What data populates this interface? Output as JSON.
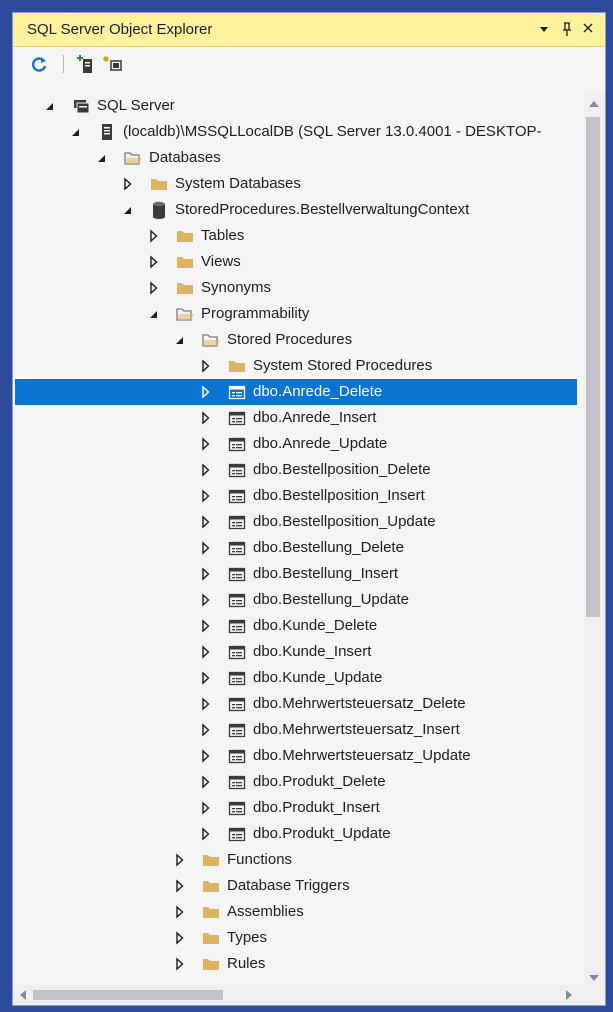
{
  "panel": {
    "title": "SQL Server Object Explorer",
    "dropdown_glyph": "▾",
    "pin_glyph": "ᵾ",
    "close_glyph": "✕"
  },
  "toolbar": {
    "refresh_icon": "refresh-icon",
    "add_server_icon": "add-sql-server-icon",
    "add_connection_icon": "add-connection-icon"
  },
  "tree": {
    "nodes": [
      {
        "label": "SQL Server",
        "level": 0,
        "state": "expanded",
        "icon": "server-group-icon"
      },
      {
        "label": "(localdb)\\MSSQLLocalDB (SQL Server 13.0.4001 - DESKTOP-",
        "level": 1,
        "state": "expanded",
        "icon": "server-icon"
      },
      {
        "label": "Databases",
        "level": 2,
        "state": "expanded",
        "icon": "folder-open-icon"
      },
      {
        "label": "System Databases",
        "level": 3,
        "state": "collapsed",
        "icon": "folder-icon"
      },
      {
        "label": "StoredProcedures.BestellverwaltungContext",
        "level": 3,
        "state": "expanded",
        "icon": "database-icon"
      },
      {
        "label": "Tables",
        "level": 4,
        "state": "collapsed",
        "icon": "folder-icon"
      },
      {
        "label": "Views",
        "level": 4,
        "state": "collapsed",
        "icon": "folder-icon"
      },
      {
        "label": "Synonyms",
        "level": 4,
        "state": "collapsed",
        "icon": "folder-icon"
      },
      {
        "label": "Programmability",
        "level": 4,
        "state": "expanded",
        "icon": "folder-open-icon"
      },
      {
        "label": "Stored Procedures",
        "level": 5,
        "state": "expanded",
        "icon": "folder-open-icon"
      },
      {
        "label": "System Stored Procedures",
        "level": 6,
        "state": "collapsed",
        "icon": "folder-icon"
      },
      {
        "label": "dbo.Anrede_Delete",
        "level": 6,
        "state": "collapsed",
        "icon": "stored-procedure-icon",
        "selected": true
      },
      {
        "label": "dbo.Anrede_Insert",
        "level": 6,
        "state": "collapsed",
        "icon": "stored-procedure-icon"
      },
      {
        "label": "dbo.Anrede_Update",
        "level": 6,
        "state": "collapsed",
        "icon": "stored-procedure-icon"
      },
      {
        "label": "dbo.Bestellposition_Delete",
        "level": 6,
        "state": "collapsed",
        "icon": "stored-procedure-icon"
      },
      {
        "label": "dbo.Bestellposition_Insert",
        "level": 6,
        "state": "collapsed",
        "icon": "stored-procedure-icon"
      },
      {
        "label": "dbo.Bestellposition_Update",
        "level": 6,
        "state": "collapsed",
        "icon": "stored-procedure-icon"
      },
      {
        "label": "dbo.Bestellung_Delete",
        "level": 6,
        "state": "collapsed",
        "icon": "stored-procedure-icon"
      },
      {
        "label": "dbo.Bestellung_Insert",
        "level": 6,
        "state": "collapsed",
        "icon": "stored-procedure-icon"
      },
      {
        "label": "dbo.Bestellung_Update",
        "level": 6,
        "state": "collapsed",
        "icon": "stored-procedure-icon"
      },
      {
        "label": "dbo.Kunde_Delete",
        "level": 6,
        "state": "collapsed",
        "icon": "stored-procedure-icon"
      },
      {
        "label": "dbo.Kunde_Insert",
        "level": 6,
        "state": "collapsed",
        "icon": "stored-procedure-icon"
      },
      {
        "label": "dbo.Kunde_Update",
        "level": 6,
        "state": "collapsed",
        "icon": "stored-procedure-icon"
      },
      {
        "label": "dbo.Mehrwertsteuersatz_Delete",
        "level": 6,
        "state": "collapsed",
        "icon": "stored-procedure-icon"
      },
      {
        "label": "dbo.Mehrwertsteuersatz_Insert",
        "level": 6,
        "state": "collapsed",
        "icon": "stored-procedure-icon"
      },
      {
        "label": "dbo.Mehrwertsteuersatz_Update",
        "level": 6,
        "state": "collapsed",
        "icon": "stored-procedure-icon"
      },
      {
        "label": "dbo.Produkt_Delete",
        "level": 6,
        "state": "collapsed",
        "icon": "stored-procedure-icon"
      },
      {
        "label": "dbo.Produkt_Insert",
        "level": 6,
        "state": "collapsed",
        "icon": "stored-procedure-icon"
      },
      {
        "label": "dbo.Produkt_Update",
        "level": 6,
        "state": "collapsed",
        "icon": "stored-procedure-icon"
      },
      {
        "label": "Functions",
        "level": 5,
        "state": "collapsed",
        "icon": "folder-icon"
      },
      {
        "label": "Database Triggers",
        "level": 5,
        "state": "collapsed",
        "icon": "folder-icon"
      },
      {
        "label": "Assemblies",
        "level": 5,
        "state": "collapsed",
        "icon": "folder-icon"
      },
      {
        "label": "Types",
        "level": 5,
        "state": "collapsed",
        "icon": "folder-icon"
      },
      {
        "label": "Rules",
        "level": 5,
        "state": "collapsed",
        "icon": "folder-icon"
      }
    ]
  },
  "colors": {
    "title_bar": "#fff29d",
    "selection": "#0a74d0",
    "folder": "#dcb45e",
    "window_border": "#2e4a9a"
  }
}
